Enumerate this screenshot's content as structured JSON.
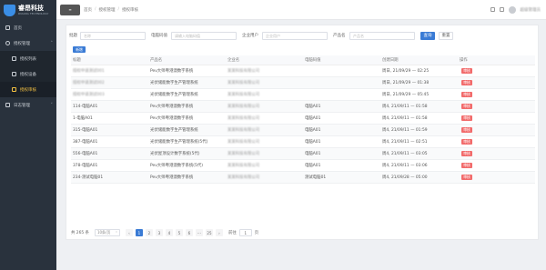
{
  "app": {
    "name": "睿昂科技",
    "name_en": "RUIANG TECHNOLOGY"
  },
  "sidebar": {
    "items": [
      {
        "label": "首页",
        "icon": "home-icon"
      },
      {
        "label": "授权管理",
        "icon": "gear-icon"
      },
      {
        "label": "授权列表",
        "icon": "list-icon"
      },
      {
        "label": "授权设备",
        "icon": "device-icon"
      },
      {
        "label": "授权审核",
        "icon": "audit-icon"
      },
      {
        "label": "日志管理",
        "icon": "log-icon"
      }
    ]
  },
  "topbar": {
    "fold_label": "≡",
    "crumbs": [
      "首页",
      "授权管理",
      "授权审核"
    ],
    "user": "超级管理员"
  },
  "filters": {
    "name_label": "批题",
    "name_placeholder": "名称",
    "cert_label": "电脑码值",
    "cert_placeholder": "请输入电脑码值",
    "company_label": "企业用户",
    "company_placeholder": "企业用户",
    "product_label": "产品名",
    "product_placeholder": "产品名",
    "query": "查询",
    "reset": "重置"
  },
  "add_button": "新增",
  "table": {
    "headers": [
      "标题",
      "产品名",
      "企业名",
      "电脑码值",
      "创建日期",
      "操作"
    ],
    "action": "审核",
    "rows": [
      [
        "授权申请测试001",
        "Pev大师粤港澳数字系统",
        "某某科技有限公司",
        "",
        "周日, 21/09/29 — 02:25"
      ],
      [
        "授权申请测试002",
        "光伏储能数字生产管理系统",
        "某某科技有限公司",
        "",
        "周日, 21/09/29 — 01:38"
      ],
      [
        "授权申请测试003",
        "光伏储能数字生产管理系统",
        "某某科技有限公司",
        "",
        "周日, 21/09/29 — 05:45"
      ],
      [
        "114-电脑A01",
        "Pev大师粤港澳数字系统",
        "某某科技有限公司",
        "电脑A01",
        "周4, 21/09/11 — 01:58"
      ],
      [
        "1-电脑A01",
        "Pev大师粤港澳数字系统",
        "某某科技有限公司",
        "电脑A01",
        "周4, 21/09/11 — 01:58"
      ],
      [
        "315-电脑A01",
        "光伏储能数字生产管理系统",
        "某某科技有限公司",
        "电脑A01",
        "周4, 21/09/11 — 01:59"
      ],
      [
        "387-电脑A01",
        "光伏储能数字生产管理系统(5代)",
        "某某科技有限公司",
        "电脑A01",
        "周4, 21/09/11 — 02:51"
      ],
      [
        "556-电脑A01",
        "光伏屋顶设计数字系统(5代)",
        "某某科技有限公司",
        "电脑A01",
        "周4, 21/09/11 — 03:05"
      ],
      [
        "378-电脑A01",
        "Pev大师粤港澳数字系统(5代)",
        "某某科技有限公司",
        "电脑A01",
        "周4, 21/09/11 — 03:06"
      ],
      [
        "234-测试电脑01",
        "Pev大师粤港澳数字系统",
        "某某科技有限公司",
        "测试电脑01",
        "周4, 21/09/28 — 05:00"
      ]
    ]
  },
  "pager": {
    "total": "共 265 条",
    "size": "10条/页",
    "pages": [
      "1",
      "2",
      "3",
      "4",
      "5",
      "6",
      "···",
      "25"
    ],
    "goto_label": "前往",
    "goto_value": "1",
    "goto_suffix": "页"
  }
}
